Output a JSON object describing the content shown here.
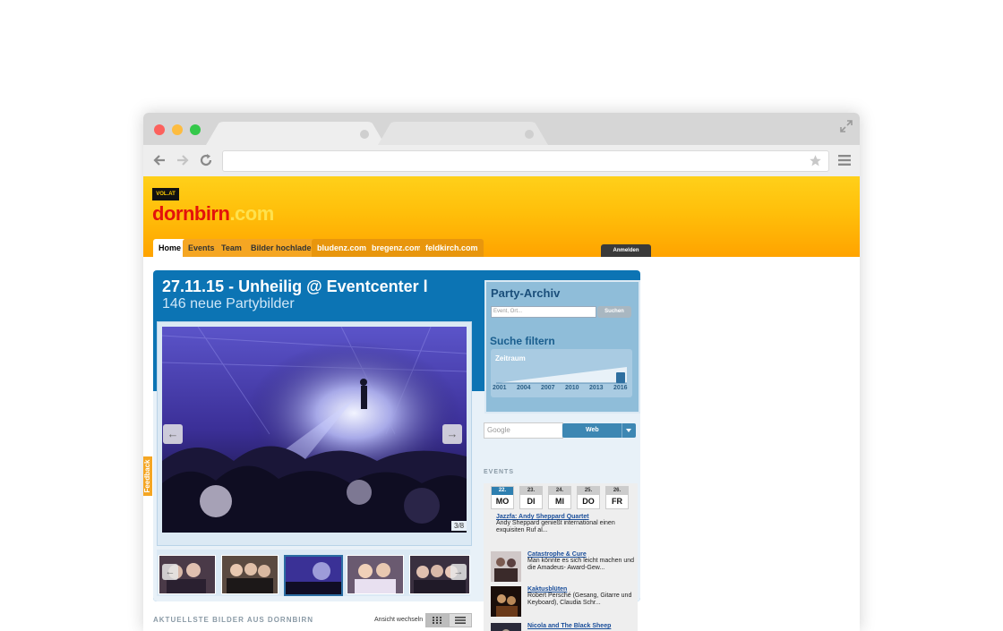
{
  "site": {
    "vol_badge": "VOL.AT",
    "logo_main": "dornbirn",
    "logo_tld": ".com"
  },
  "nav": {
    "tabs": [
      "Home",
      "Events",
      "Team",
      "Bilder hochladen",
      "bludenz.com",
      "bregenz.com",
      "feldkirch.com"
    ],
    "login": "Anmelden"
  },
  "feedback_label": "Feedback",
  "gallery": {
    "title": "27.11.15 - Unheilig @ Eventcenter l",
    "subtitle": "146 neue Partybilder",
    "counter": "3/8",
    "prev_icon": "arrow-left-icon",
    "next_icon": "arrow-right-icon",
    "thumbnails": [
      "thumb-1",
      "thumb-2",
      "thumb-3",
      "thumb-4",
      "thumb-5"
    ]
  },
  "archive": {
    "title": "Party-Archiv",
    "search_placeholder": "Event, Ort...",
    "search_button": "Suchen",
    "filter_title": "Suche filtern",
    "range_label": "Zeitraum",
    "years": [
      "2001",
      "2004",
      "2007",
      "2010",
      "2013",
      "2016"
    ]
  },
  "google_search": {
    "placeholder": "Google",
    "button": "Web",
    "dropdown_icon": "triangle-down-icon"
  },
  "events": {
    "heading": "EVENTS",
    "days": [
      {
        "num": "22.",
        "name": "MO",
        "active": true
      },
      {
        "num": "23.",
        "name": "DI",
        "active": false
      },
      {
        "num": "24.",
        "name": "MI",
        "active": false
      },
      {
        "num": "25.",
        "name": "DO",
        "active": false
      },
      {
        "num": "26.",
        "name": "FR",
        "active": false
      }
    ],
    "items": [
      {
        "title": "Jazzfa: Andy Sheppard Quartet",
        "desc": "Andy Sheppard genießt international einen exquisiten Ruf al..."
      },
      {
        "title": "Catastrophe & Cure",
        "desc": "Man könnte es sich leicht machen und die Amadeus- Award-Gew..."
      },
      {
        "title": "Kaktusblüten",
        "desc": "Robert Persché (Gesang, Gitarre und Keyboard), Claudia Schr..."
      },
      {
        "title": "Nicola and The Black Sheep",
        "desc": ""
      }
    ]
  },
  "latest": {
    "heading": "AKTUELLSTE BILDER AUS DORNBIRN",
    "view_label": "Ansicht wechseln",
    "grid_icon": "grid-view-icon",
    "list_icon": "list-view-icon"
  },
  "colors": {
    "header_yellow": "#ffbf0a",
    "gallery_blue": "#0c74b4",
    "archive_blue": "#8fbdd9",
    "logo_red": "#e3120b"
  }
}
